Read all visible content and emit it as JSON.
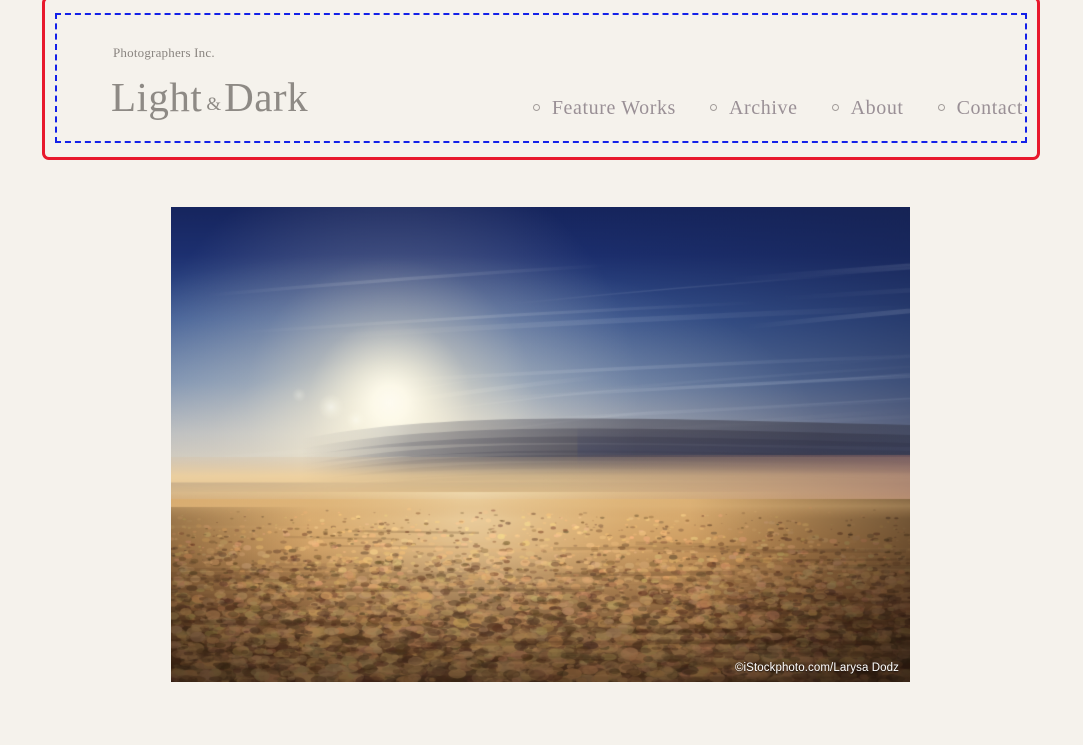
{
  "site": {
    "background_color": "#f5f2ec",
    "tagline": "Photographers Inc.",
    "logo": {
      "first": "Light",
      "amp": "&",
      "second": "Dark",
      "color": "#8e8a85"
    }
  },
  "header": {
    "outline_color": "#e8192c",
    "inner_dash_color": "#1421e8",
    "nav": {
      "items": [
        {
          "label": "Feature Works",
          "bullet": "circle-bullet-icon"
        },
        {
          "label": "Archive",
          "bullet": "circle-bullet-icon"
        },
        {
          "label": "About",
          "bullet": "circle-bullet-icon"
        },
        {
          "label": "Contact",
          "bullet": "circle-bullet-icon"
        }
      ],
      "text_color": "#9a9096"
    }
  },
  "main": {
    "hero": {
      "caption": "©iStockphoto.com/Larysa Dodz",
      "caption_color": "#ffffff",
      "alt": "Sunrise above a layer of clouds seen from an airplane",
      "palette": {
        "sky_top": "#1b2a63",
        "sky_mid": "#3a5691",
        "glow": "#fff8e6",
        "cloud_band": "#5c5f70",
        "cloud_low": "#c89a5e",
        "cloud_dark": "#6b4526"
      }
    }
  }
}
